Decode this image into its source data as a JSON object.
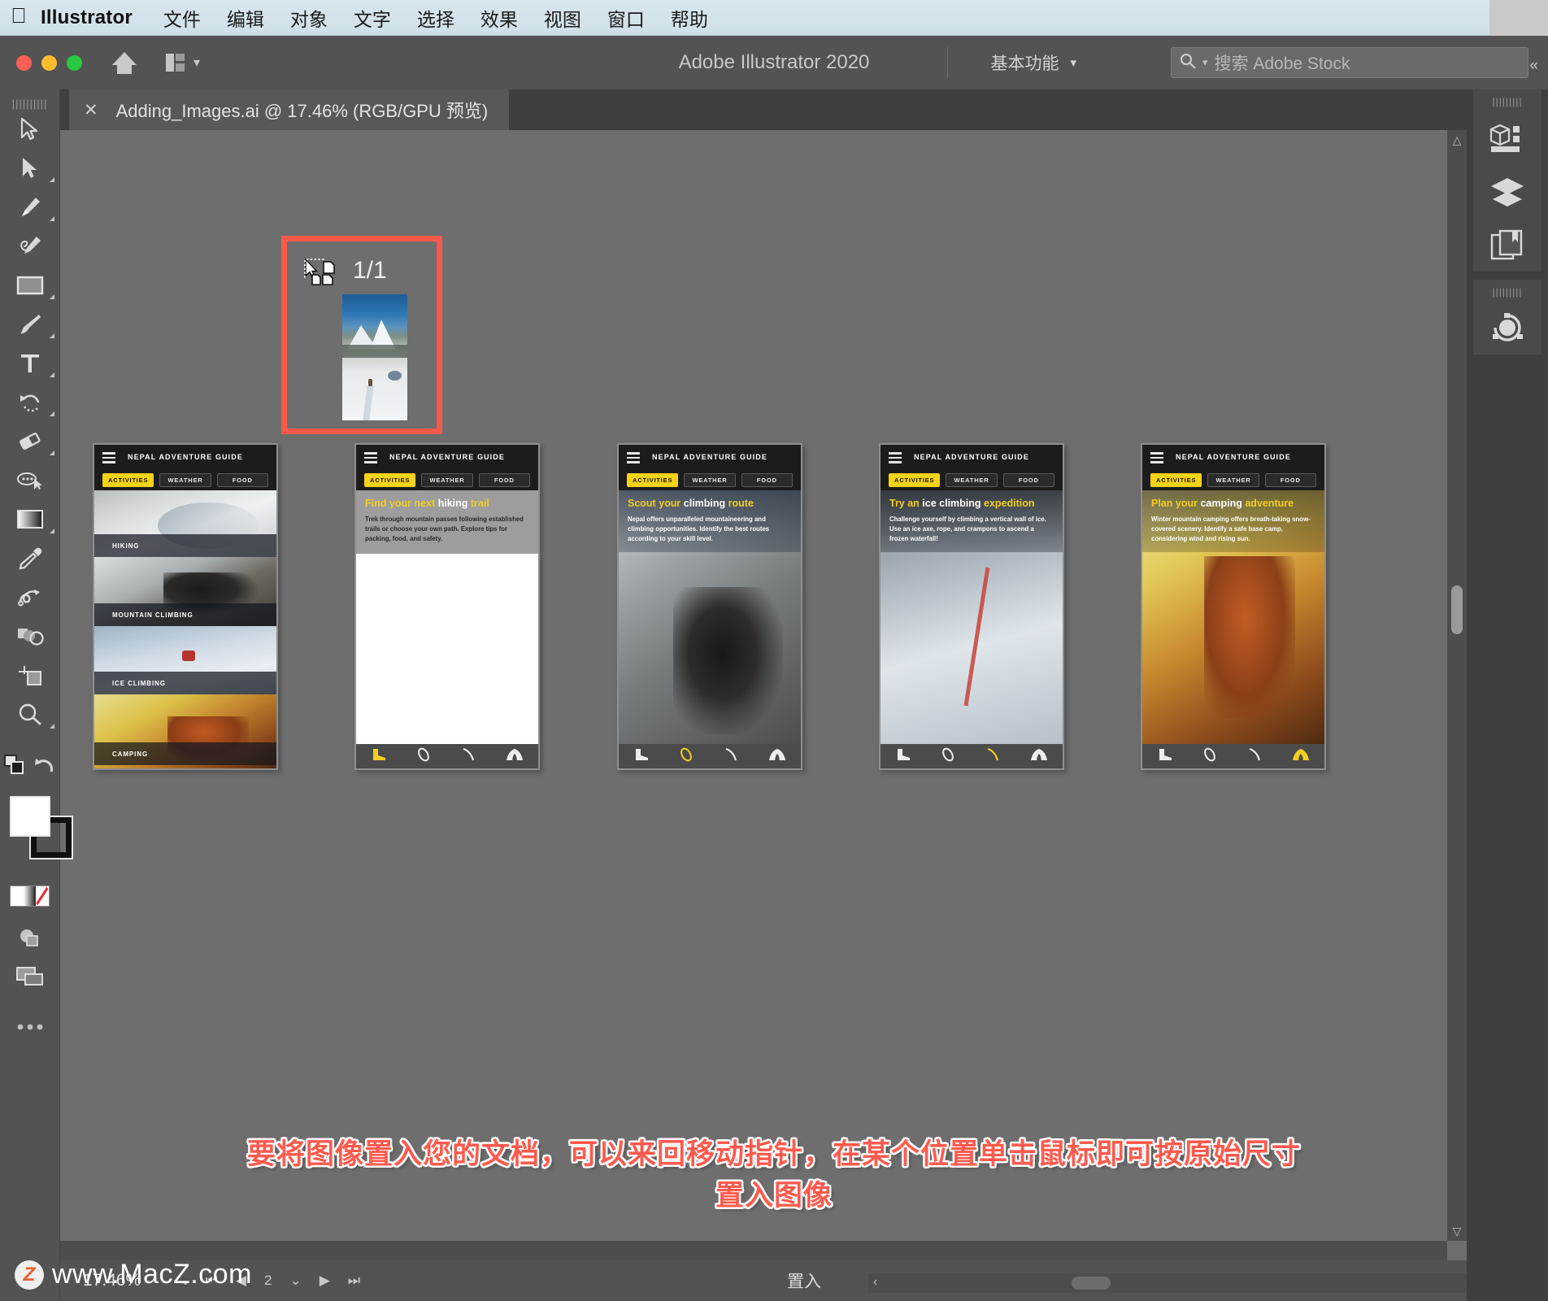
{
  "macmenu": {
    "apple_icon": "apple-icon",
    "app_name": "Illustrator",
    "items": [
      "文件",
      "编辑",
      "对象",
      "文字",
      "选择",
      "效果",
      "视图",
      "窗口",
      "帮助"
    ]
  },
  "appbar": {
    "title": "Adobe Illustrator 2020",
    "home_icon": "home-icon",
    "arrange_icon": "arrange-documents-icon",
    "workspace_label": "基本功能",
    "search_icon": "search-icon",
    "search_placeholder": "搜索 Adobe Stock"
  },
  "tabbar": {
    "close_label": "✕",
    "document_title": "Adding_Images.ai @ 17.46% (RGB/GPU 预览)",
    "collapse_label": "«"
  },
  "toolbar": {
    "tools": [
      {
        "name": "selection-tool",
        "icon": "arrow-cursor-icon",
        "has_flyout": false
      },
      {
        "name": "direct-selection-tool",
        "icon": "filled-arrow-icon",
        "has_flyout": true
      },
      {
        "name": "pen-tool",
        "icon": "pen-icon",
        "has_flyout": true
      },
      {
        "name": "curvature-tool",
        "icon": "curvature-pen-icon",
        "has_flyout": false
      },
      {
        "name": "rectangle-tool",
        "icon": "rectangle-icon",
        "has_flyout": true
      },
      {
        "name": "paintbrush-tool",
        "icon": "paintbrush-icon",
        "has_flyout": true
      },
      {
        "name": "type-tool",
        "icon": "type-T-icon",
        "has_flyout": true
      },
      {
        "name": "rotate-tool",
        "icon": "rotate-arrow-icon",
        "has_flyout": true
      },
      {
        "name": "eraser-tool",
        "icon": "eraser-icon",
        "has_flyout": true
      },
      {
        "name": "shaper-tool",
        "icon": "shaper-lasso-icon",
        "has_flyout": false
      },
      {
        "name": "gradient-tool",
        "icon": "gradient-swatch-icon",
        "has_flyout": true
      },
      {
        "name": "eyedropper-tool",
        "icon": "eyedropper-icon",
        "has_flyout": false
      },
      {
        "name": "blend-tool",
        "icon": "blend-swirl-icon",
        "has_flyout": false
      },
      {
        "name": "shape-builder-tool",
        "icon": "shape-builder-icon",
        "has_flyout": false
      },
      {
        "name": "artboard-tool",
        "icon": "artboard-icon",
        "has_flyout": false
      },
      {
        "name": "zoom-tool",
        "icon": "magnifier-icon",
        "has_flyout": true
      }
    ],
    "extras": [
      {
        "name": "fill-stroke-swap",
        "icon": "swap-squares-icon"
      },
      {
        "name": "reset-fill-stroke",
        "icon": "undo-arrow-icon"
      },
      {
        "name": "fill-swatch",
        "icon": "fill-swatch-icon",
        "color": "#ffffff"
      },
      {
        "name": "stroke-swatch",
        "icon": "stroke-swatch-icon",
        "color": "#000000"
      },
      {
        "name": "color-mode-plain",
        "icon": "plain-color-icon"
      },
      {
        "name": "color-mode-gradient",
        "icon": "gradient-icon"
      },
      {
        "name": "color-mode-none",
        "icon": "none-slash-icon"
      },
      {
        "name": "drawing-mode",
        "icon": "draw-normal-icon"
      },
      {
        "name": "screen-mode",
        "icon": "screen-mode-icon"
      },
      {
        "name": "edit-toolbar",
        "icon": "ellipsis-icon"
      }
    ]
  },
  "canvas": {
    "place_cursor": {
      "icon": "place-image-cursor-icon",
      "counter": "1/1",
      "thumbnail_alt": "snow-mountain-hiker-photo",
      "highlight_color": "#f75a4a"
    },
    "phones": [
      {
        "id": "phone-activities-index",
        "title": "NEPAL ADVENTURE GUIDE",
        "tabs": [
          "ACTIVITIES",
          "WEATHER",
          "FOOD"
        ],
        "active_tab": "ACTIVITIES",
        "sections": [
          "HIKING",
          "MOUNTAIN CLIMBING",
          "ICE CLIMBING",
          "CAMPING"
        ]
      },
      {
        "id": "phone-hiking",
        "title": "NEPAL ADVENTURE GUIDE",
        "tabs": [
          "ACTIVITIES",
          "WEATHER",
          "FOOD"
        ],
        "active_tab": "ACTIVITIES",
        "heading_parts": [
          "Find your next ",
          "hiking",
          " trail"
        ],
        "body": "Trek through mountain passes following established trails or choose your own path. Explore tips for packing, food, and safety.",
        "footer_icons": [
          "boot-icon",
          "carabiner-icon",
          "ice-axe-icon",
          "tent-icon"
        ]
      },
      {
        "id": "phone-climbing",
        "title": "NEPAL ADVENTURE GUIDE",
        "tabs": [
          "ACTIVITIES",
          "WEATHER",
          "FOOD"
        ],
        "active_tab": "ACTIVITIES",
        "heading_parts": [
          "Scout your ",
          "climbing",
          " route"
        ],
        "body": "Nepal offers unparalleled mountaineering and climbing opportunities. Identify the best routes according to your skill level.",
        "footer_icons": [
          "boot-icon",
          "carabiner-icon",
          "ice-axe-icon",
          "tent-icon"
        ]
      },
      {
        "id": "phone-ice-climbing",
        "title": "NEPAL ADVENTURE GUIDE",
        "tabs": [
          "ACTIVITIES",
          "WEATHER",
          "FOOD"
        ],
        "active_tab": "ACTIVITIES",
        "heading_parts": [
          "Try an ",
          "ice climbing",
          " expedition"
        ],
        "body": "Challenge yourself by climbing a vertical wall of ice. Use an ice axe, rope, and crampons to ascend a frozen waterfall!",
        "footer_icons": [
          "boot-icon",
          "carabiner-icon",
          "ice-axe-icon",
          "tent-icon"
        ]
      },
      {
        "id": "phone-camping",
        "title": "NEPAL ADVENTURE GUIDE",
        "tabs": [
          "ACTIVITIES",
          "WEATHER",
          "FOOD"
        ],
        "active_tab": "ACTIVITIES",
        "heading_parts": [
          "Plan your ",
          "camping",
          " adventure"
        ],
        "body": "Winter mountain camping offers breath-taking snow-covered scenery. Identify a safe base camp, considering wind and rising sun.",
        "footer_icons": [
          "boot-icon",
          "carabiner-icon",
          "ice-axe-icon",
          "tent-icon"
        ]
      }
    ]
  },
  "annotation": {
    "line1": "要将图像置入您的文档，可以来回移动指针，在某个位置单击鼠标即可按原始尺寸",
    "line2": "置入图像",
    "color": "#ff5a4d"
  },
  "watermark": {
    "badge": "Z",
    "text": "www.MacZ.com"
  },
  "statusbar": {
    "zoom": "17.46%",
    "zoom_chevron": "⌄",
    "nav_first": "⏮",
    "nav_prev": "◀",
    "page_number": "2",
    "page_chevron": "⌄",
    "nav_next": "▶",
    "nav_last": "⏭",
    "status_text": "置入"
  },
  "rightpanel": {
    "collapse_label": "«",
    "items": [
      {
        "name": "properties-panel",
        "icon": "properties-cube-icon"
      },
      {
        "name": "layers-panel",
        "icon": "layers-stack-icon"
      },
      {
        "name": "libraries-panel",
        "icon": "libraries-book-icon"
      },
      {
        "name": "recolor-artwork-panel",
        "icon": "color-wheel-icon"
      }
    ]
  }
}
